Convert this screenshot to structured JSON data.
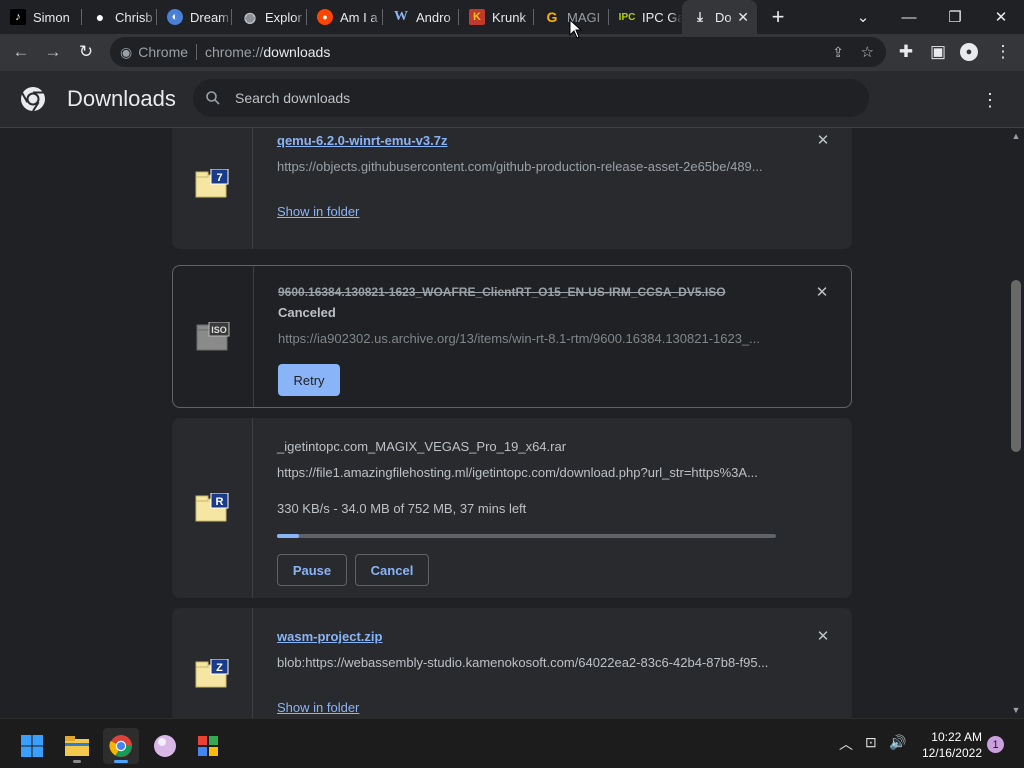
{
  "tabs": [
    {
      "label": "Simon",
      "icon": "tiktok-icon"
    },
    {
      "label": "Chrisb",
      "icon": "apple-icon"
    },
    {
      "label": "Dream",
      "icon": "dreamstudio-icon"
    },
    {
      "label": "Explor",
      "icon": "globe-icon"
    },
    {
      "label": "Am I a",
      "icon": "reddit-icon"
    },
    {
      "label": "Andro",
      "icon": "wikipedia-icon"
    },
    {
      "label": "Krunk",
      "icon": "krunker-icon"
    },
    {
      "label": "MAGI",
      "icon": "google-icon"
    },
    {
      "label": "IPC Ga",
      "icon": "ipc-games-icon"
    },
    {
      "label": "Do",
      "icon": "download-icon",
      "active": true
    }
  ],
  "toolbar": {
    "site_label": "Chrome",
    "url_scheme": "chrome://",
    "url_host": "downloads"
  },
  "header": {
    "title": "Downloads",
    "search_placeholder": "Search downloads"
  },
  "downloads": [
    {
      "filename": "qemu-6.2.0-winrt-emu-v3.7z",
      "url": "https://objects.githubusercontent.com/github-production-release-asset-2e65be/489...",
      "action": "Show in folder",
      "badge": "7"
    },
    {
      "filename": "9600.16384.130821-1623_WOAFRE_ClientRT_O15_EN-US-IRM_CCSA_DV5.ISO",
      "status": "Canceled",
      "url": "https://ia902302.us.archive.org/13/items/win-rt-8.1-rtm/9600.16384.130821-1623_...",
      "action": "Retry",
      "badge": "ISO"
    },
    {
      "filename": "_igetintopc.com_MAGIX_VEGAS_Pro_19_x64.rar",
      "url": "https://file1.amazingfilehosting.ml/igetintopc.com/download.php?url_str=https%3A...",
      "progress_text": "330 KB/s - 34.0 MB of 752 MB, 37 mins left",
      "progress_fraction": 0.045,
      "pause": "Pause",
      "cancel": "Cancel",
      "badge": "R"
    },
    {
      "filename": "wasm-project.zip",
      "url": "blob:https://webassembly-studio.kamenokosoft.com/64022ea2-83c6-42b4-87b8-f95...",
      "action": "Show in folder",
      "badge": "Z"
    }
  ],
  "taskbar": {
    "time": "10:22 AM",
    "date": "12/16/2022",
    "notifications": "1"
  },
  "colors": {
    "accent": "#8ab4f8",
    "background": "#202124",
    "card": "#292a2d"
  }
}
